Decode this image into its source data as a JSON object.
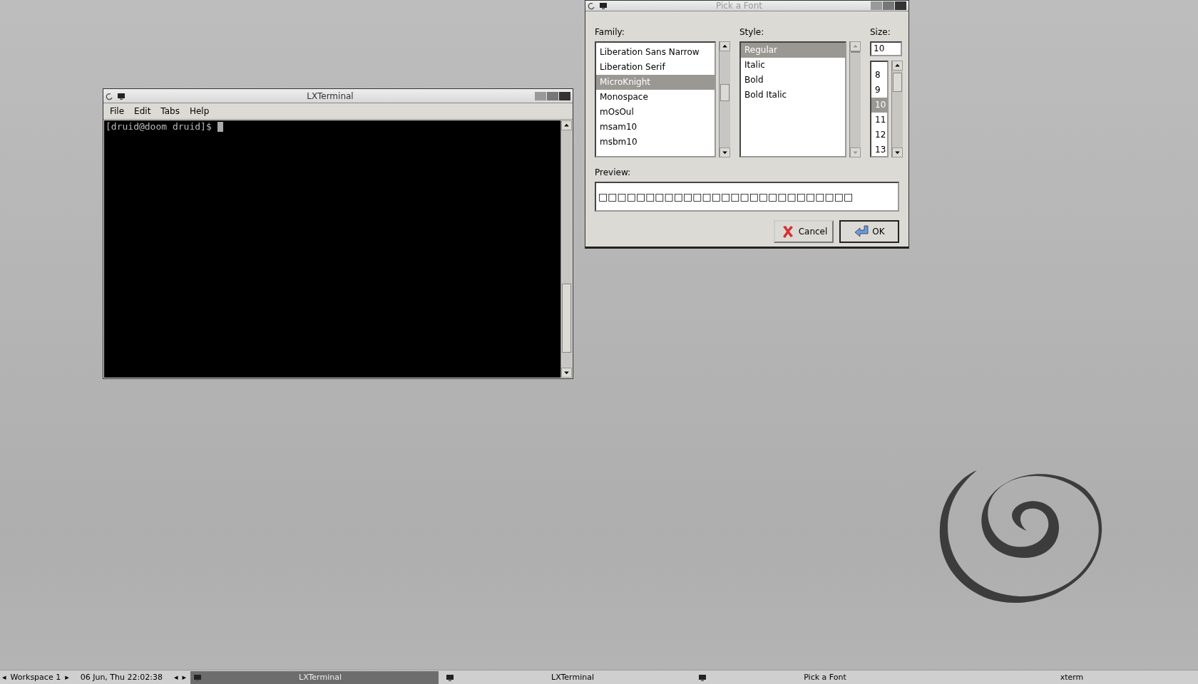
{
  "windows": [
    {
      "kind": "terminal",
      "title": "LXTerminal",
      "active": true,
      "menu": [
        "File",
        "Edit",
        "Tabs",
        "Help"
      ],
      "prompt": "[druid@doom druid]$"
    },
    {
      "kind": "font_dialog",
      "title": "Pick a Font",
      "active": false,
      "family_label": "Family:",
      "style_label": "Style:",
      "size_label": "Size:",
      "families": [
        {
          "label": "Liberation Sans Narrow",
          "selected": false
        },
        {
          "label": "Liberation Serif",
          "selected": false
        },
        {
          "label": "MicroKnight",
          "selected": true
        },
        {
          "label": "Monospace",
          "selected": false
        },
        {
          "label": "mOsOul",
          "selected": false
        },
        {
          "label": "msam10",
          "selected": false
        },
        {
          "label": "msbm10",
          "selected": false
        }
      ],
      "styles": [
        {
          "label": "Regular",
          "selected": true
        },
        {
          "label": "Italic",
          "selected": false
        },
        {
          "label": "Bold",
          "selected": false
        },
        {
          "label": "Bold Italic",
          "selected": false
        }
      ],
      "size_value": "10",
      "sizes": [
        {
          "label": "8",
          "selected": false
        },
        {
          "label": "9",
          "selected": false
        },
        {
          "label": "10",
          "selected": true
        },
        {
          "label": "11",
          "selected": false
        },
        {
          "label": "12",
          "selected": false
        },
        {
          "label": "13",
          "selected": false
        }
      ],
      "preview_label": "Preview:",
      "preview_text": "□□□□□□□□□□□□□□□□□□□□□□□□□□□",
      "buttons": [
        {
          "kind": "cancel",
          "label": "Cancel"
        },
        {
          "kind": "ok",
          "label": "OK"
        }
      ]
    }
  ],
  "taskbar": {
    "prev": "◂",
    "workspace": "Workspace 1",
    "next": "▸",
    "clock": "06 Jun, Thu 22:02:38",
    "left": "◂",
    "right": "▸",
    "tasks": [
      {
        "label": "LXTerminal",
        "selected": true,
        "icon": true
      },
      {
        "label": "LXTerminal",
        "selected": false,
        "icon": true
      },
      {
        "label": "Pick a Font",
        "selected": false,
        "icon": true
      },
      {
        "label": "xterm",
        "selected": false,
        "icon": false
      }
    ]
  }
}
